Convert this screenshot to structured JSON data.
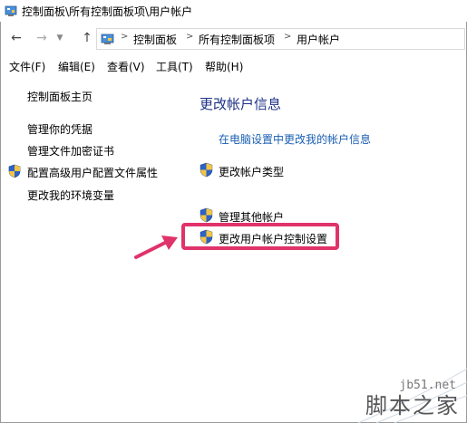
{
  "window": {
    "title": "控制面板\\所有控制面板项\\用户帐户",
    "icon": "control-panel-icon"
  },
  "address_bar": {
    "breadcrumbs": [
      "控制面板",
      "所有控制面板项",
      "用户帐户"
    ],
    "back_icon": "arrow-left-icon",
    "forward_icon": "arrow-right-icon",
    "up_icon": "arrow-up-icon"
  },
  "menu": {
    "items": [
      "文件(F)",
      "编辑(E)",
      "查看(V)",
      "工具(T)",
      "帮助(H)"
    ]
  },
  "left_nav": {
    "home": "控制面板主页",
    "links": [
      "管理你的凭据",
      "管理文件加密证书",
      "配置高级用户配置文件属性",
      "更改我的环境变量"
    ]
  },
  "main": {
    "heading": "更改帐户信息",
    "links": {
      "pc_settings": "在电脑设置中更改我的帐户信息",
      "account_type": "更改帐户类型",
      "manage_other": "管理其他帐户",
      "uac_settings": "更改用户帐户控制设置"
    }
  },
  "colors": {
    "highlight": "#e0336a",
    "link": "#1a5fb4",
    "heading": "#1e3287"
  },
  "watermark": {
    "url": "jb51.net",
    "name": "脚本之家"
  }
}
